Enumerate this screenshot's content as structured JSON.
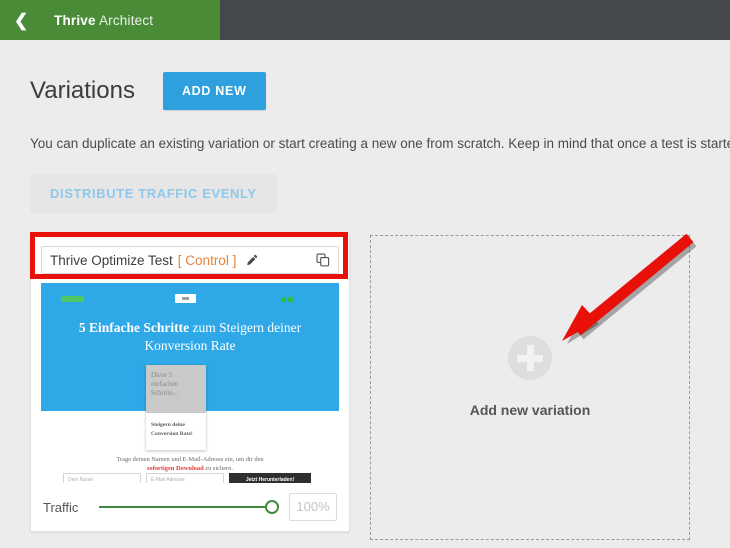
{
  "topbar": {
    "back_icon": "chevron-left-icon",
    "brand_bold": "Thrive",
    "brand_light": "Architect",
    "green_hex": "#4a8b38",
    "dark_hex": "#45494d"
  },
  "page": {
    "title": "Variations",
    "add_new_label": "ADD NEW",
    "description": "You can duplicate an existing variation or start creating a new one from scratch. Keep in mind that once a test is starte",
    "distribute_label": "DISTRIBUTE TRAFFIC EVENLY",
    "accent_hex": "#2ea0dd",
    "background_hex": "#ececec"
  },
  "variation": {
    "name": "Thrive Optimize Test",
    "control_tag": "[ Control ]",
    "control_hex": "#e8833a",
    "edit_icon": "pencil-icon",
    "duplicate_icon": "copy-icon",
    "thumbnail": {
      "headline_bold": "5 Einfache Schritte",
      "headline_rest": " zum Steigern deiner Konversion Rate",
      "book_title": "Diese 5 einfachen Schritte...",
      "book_subtitle": "Steigern deine Conversion Rate!",
      "form_intro_line1": "Trage deinen Namen und E-Mail-Adresse ein, um dir den",
      "form_intro_bold": "sofortigen Download",
      "form_intro_line2": " zu sichern.",
      "input_name_placeholder": "Dein Name",
      "input_email_placeholder": "E-Mail Adresse",
      "submit_label": "Jetzt Herunterladen!",
      "hero_hex": "#2fa8e8"
    },
    "traffic": {
      "label": "Traffic",
      "value": "100%",
      "slider_percent": 100,
      "slider_hex": "#3f8a3f"
    }
  },
  "add_variation": {
    "label": "Add new variation",
    "plus_icon": "plus-circle-icon"
  },
  "annotations": {
    "highlight_color": "#e81008",
    "arrow_color": "#e81008"
  }
}
